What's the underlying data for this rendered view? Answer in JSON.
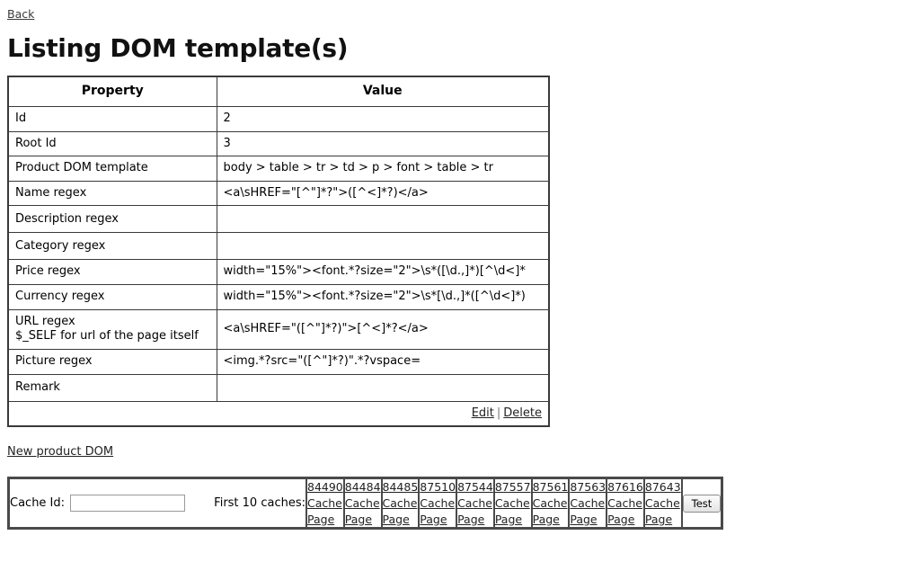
{
  "nav": {
    "back_label": "Back"
  },
  "header": {
    "title": "Listing DOM template(s)"
  },
  "table": {
    "columns": [
      "Property",
      "Value"
    ],
    "rows": [
      {
        "property": "Id",
        "value": "2"
      },
      {
        "property": "Root Id",
        "value": "3"
      },
      {
        "property": "Product DOM template",
        "value": "body > table > tr > td > p > font > table > tr"
      },
      {
        "property": "Name regex",
        "value": "<a\\sHREF=\"[^\"]*?\">([^<]*?)</a>"
      },
      {
        "property": "Description regex",
        "value": ""
      },
      {
        "property": "Category regex",
        "value": ""
      },
      {
        "property": "Price regex",
        "value": "width=\"15%\"><font.*?size=\"2\">\\s*([\\d.,]*)[^\\d<]*"
      },
      {
        "property": "Currency regex",
        "value": "width=\"15%\"><font.*?size=\"2\">\\s*[\\d.,]*([^\\d<]*)"
      },
      {
        "property": "URL regex",
        "property_line2": "$_SELF for url of the page itself",
        "value": "<a\\sHREF=\"([^\"]*?)\">[^<]*?</a>"
      },
      {
        "property": "Picture regex",
        "value": "<img.*?src=\"([^\"]*?)\".*?vspace="
      },
      {
        "property": "Remark",
        "value": ""
      }
    ],
    "actions": {
      "edit_label": "Edit",
      "separator": "|",
      "delete_label": "Delete"
    }
  },
  "links": {
    "new_product_dom": "New product DOM"
  },
  "cache_bar": {
    "cache_id_label": "Cache Id:",
    "cache_id_value": "",
    "cache_id_placeholder": "",
    "first_caches_label": "First 10 caches:",
    "cache_link_labels": {
      "cache": "Cache",
      "page": "Page"
    },
    "caches": [
      {
        "id": "84490"
      },
      {
        "id": "84484"
      },
      {
        "id": "84485"
      },
      {
        "id": "87510"
      },
      {
        "id": "87544"
      },
      {
        "id": "87557"
      },
      {
        "id": "87561"
      },
      {
        "id": "87563"
      },
      {
        "id": "87616"
      },
      {
        "id": "87643"
      }
    ],
    "test_button_label": "Test"
  },
  "colors": {
    "border": "#3a3a3a",
    "link": "#222222",
    "text": "#000000",
    "background": "#ffffff"
  }
}
